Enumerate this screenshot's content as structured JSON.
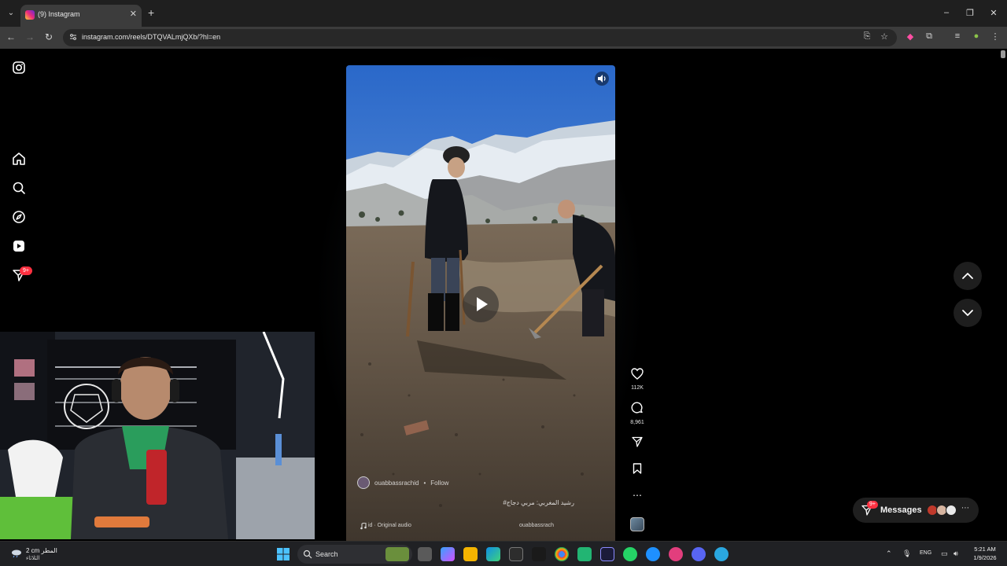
{
  "browser": {
    "tab_title": "(9) Instagram",
    "url": "instagram.com/reels/DTQVALmjQXb/?hl=en"
  },
  "sidebar": {
    "notifications_badge": "9+"
  },
  "reel": {
    "author": "ouabbassrachid",
    "separator": "•",
    "follow_label": "Follow",
    "caption": "رشيد المغربي: مربي دجاج#",
    "audio": "id · Original audio",
    "audio_user": "ouabbassrach",
    "likes": "112K",
    "comments": "8,961"
  },
  "messages": {
    "label": "Messages",
    "badge": "9+"
  },
  "taskbar": {
    "weather_temp": "2 cm المطر",
    "weather_desc": "الثلاثاء",
    "search_placeholder": "Search",
    "language": "ENG",
    "time": "5:21 AM",
    "date": "1/9/2026"
  },
  "colors": {
    "background": "#000000",
    "badge": "#ff3040",
    "chrome": "#3c3c3c"
  }
}
